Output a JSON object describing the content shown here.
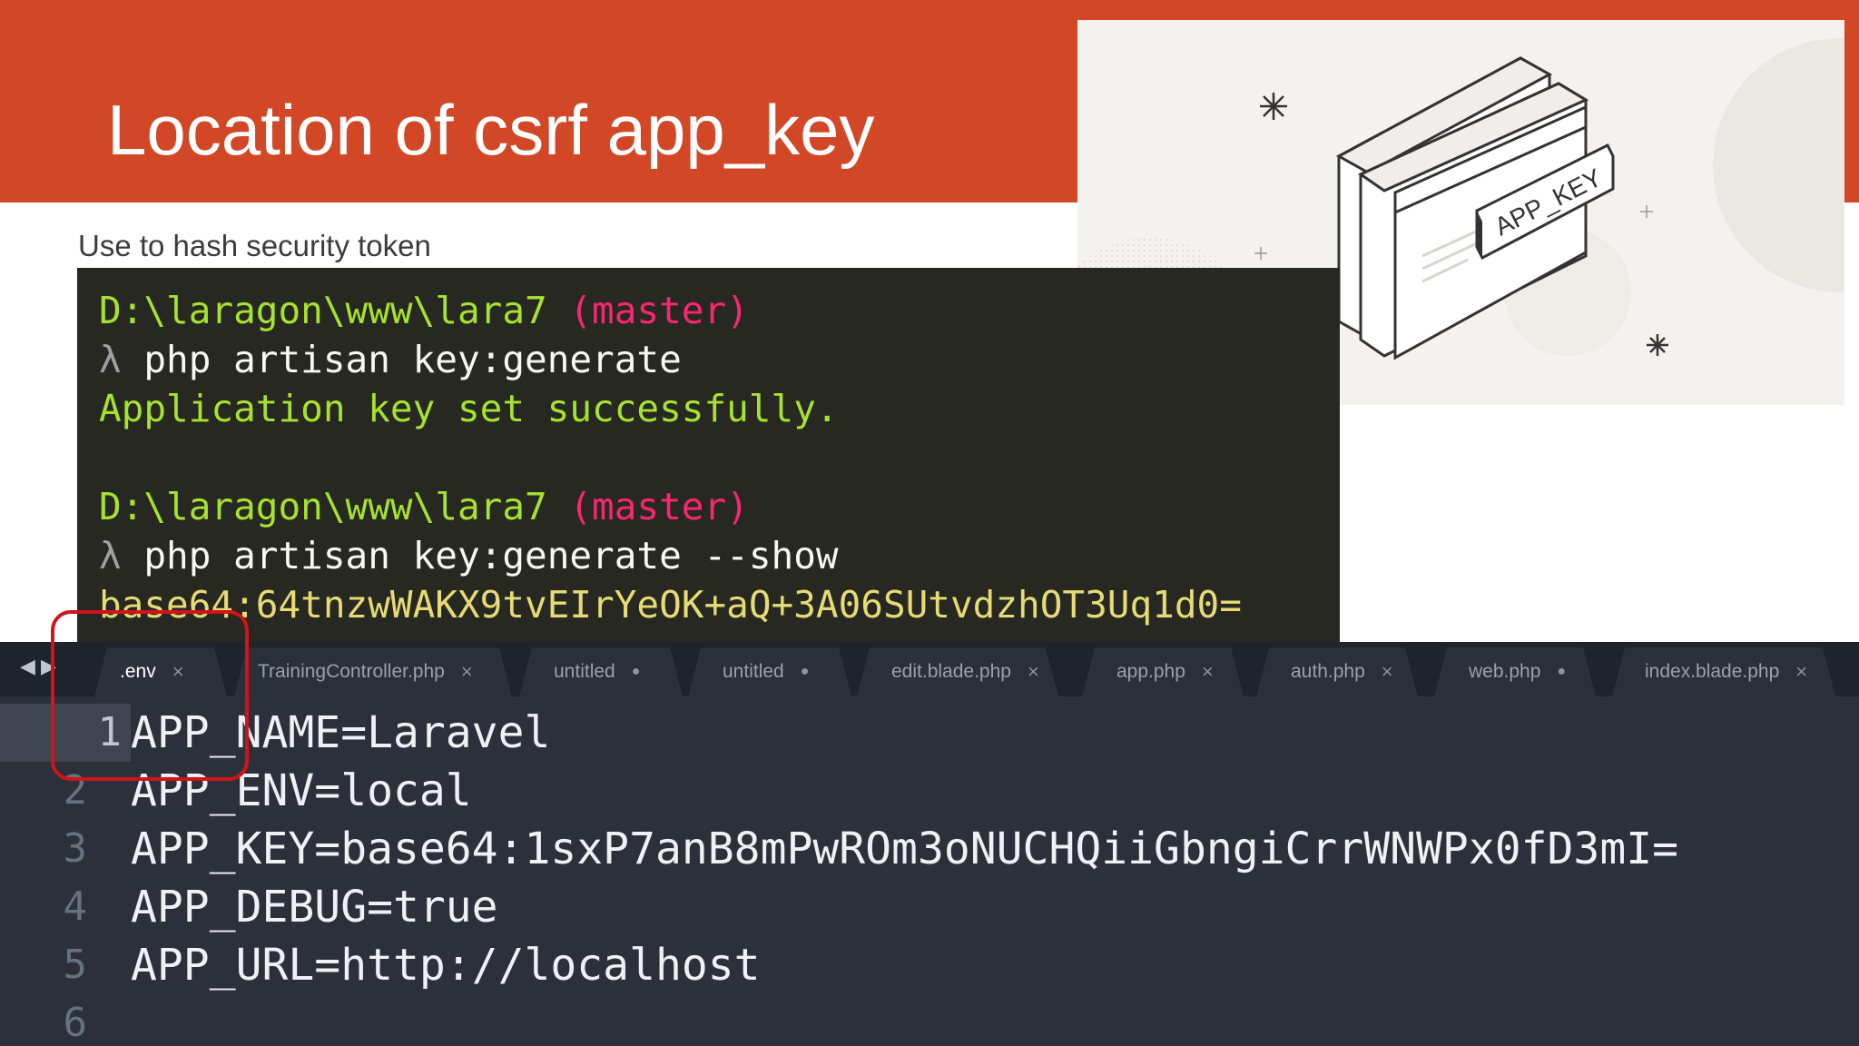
{
  "slide": {
    "title": "Location of csrf app_key",
    "subtitle": "Use to hash security token"
  },
  "illustration": {
    "label": "APP_KEY"
  },
  "terminal": {
    "blocks": [
      {
        "path": "D:\\laragon\\www\\lara7",
        "branch": "(master)",
        "prompt": "λ",
        "command": "php artisan key:generate",
        "output": "Application key set successfully."
      },
      {
        "path": "D:\\laragon\\www\\lara7",
        "branch": "(master)",
        "prompt": "λ",
        "command": "php artisan key:generate --show",
        "output": "base64:64tnzwWAKX9tvEIrYeOK+aQ+3A06SUtvdzhOT3Uq1d0="
      }
    ]
  },
  "editor": {
    "tabs": [
      {
        "label": ".env",
        "mark": "×"
      },
      {
        "label": "TrainingController.php",
        "mark": "×"
      },
      {
        "label": "untitled",
        "mark": "●"
      },
      {
        "label": "untitled",
        "mark": "●"
      },
      {
        "label": "edit.blade.php",
        "mark": "×"
      },
      {
        "label": "app.php",
        "mark": "×"
      },
      {
        "label": "auth.php",
        "mark": "×"
      },
      {
        "label": "web.php",
        "mark": "●"
      },
      {
        "label": "index.blade.php",
        "mark": "×"
      }
    ],
    "lines": [
      {
        "num": "1",
        "text": "APP_NAME=Laravel"
      },
      {
        "num": "2",
        "text": "APP_ENV=local"
      },
      {
        "num": "3",
        "text": "APP_KEY=base64:1sxP7anB8mPwROm3oNUCHQiiGbngiCrrWNWPx0fD3mI="
      },
      {
        "num": "4",
        "text": "APP_DEBUG=true"
      },
      {
        "num": "5",
        "text": "APP_URL=http://localhost"
      },
      {
        "num": "6",
        "text": ""
      }
    ]
  },
  "colors": {
    "banner": "#d24726",
    "terminal_bg": "#272822",
    "editor_bg": "#2b303b",
    "highlight": "#d1131b"
  }
}
